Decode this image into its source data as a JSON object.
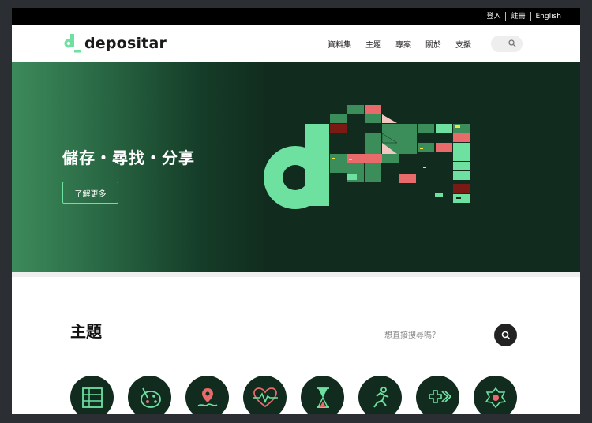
{
  "topbar": {
    "links": [
      "登入",
      "註冊",
      "English"
    ]
  },
  "header": {
    "logo_text": "depositar",
    "nav": [
      "資料集",
      "主題",
      "專案",
      "關於",
      "支援"
    ],
    "search_icon": "search-icon"
  },
  "hero": {
    "tagline": "儲存・尋找・分享",
    "button_label": "了解更多"
  },
  "themes": {
    "title": "主題",
    "search_placeholder": "想直接搜尋嗎？",
    "topic_icons": [
      "table-grid-icon",
      "palette-icon",
      "map-pin-icon",
      "heartbeat-icon",
      "hourglass-icon",
      "runner-icon",
      "arrow-forward-icon",
      "flower-icon"
    ]
  },
  "colors": {
    "brand_green": "#6ee1a0",
    "hero_dark": "#112c1e",
    "accent_red": "#e86a6a",
    "mid_green": "#3b8d5a"
  }
}
